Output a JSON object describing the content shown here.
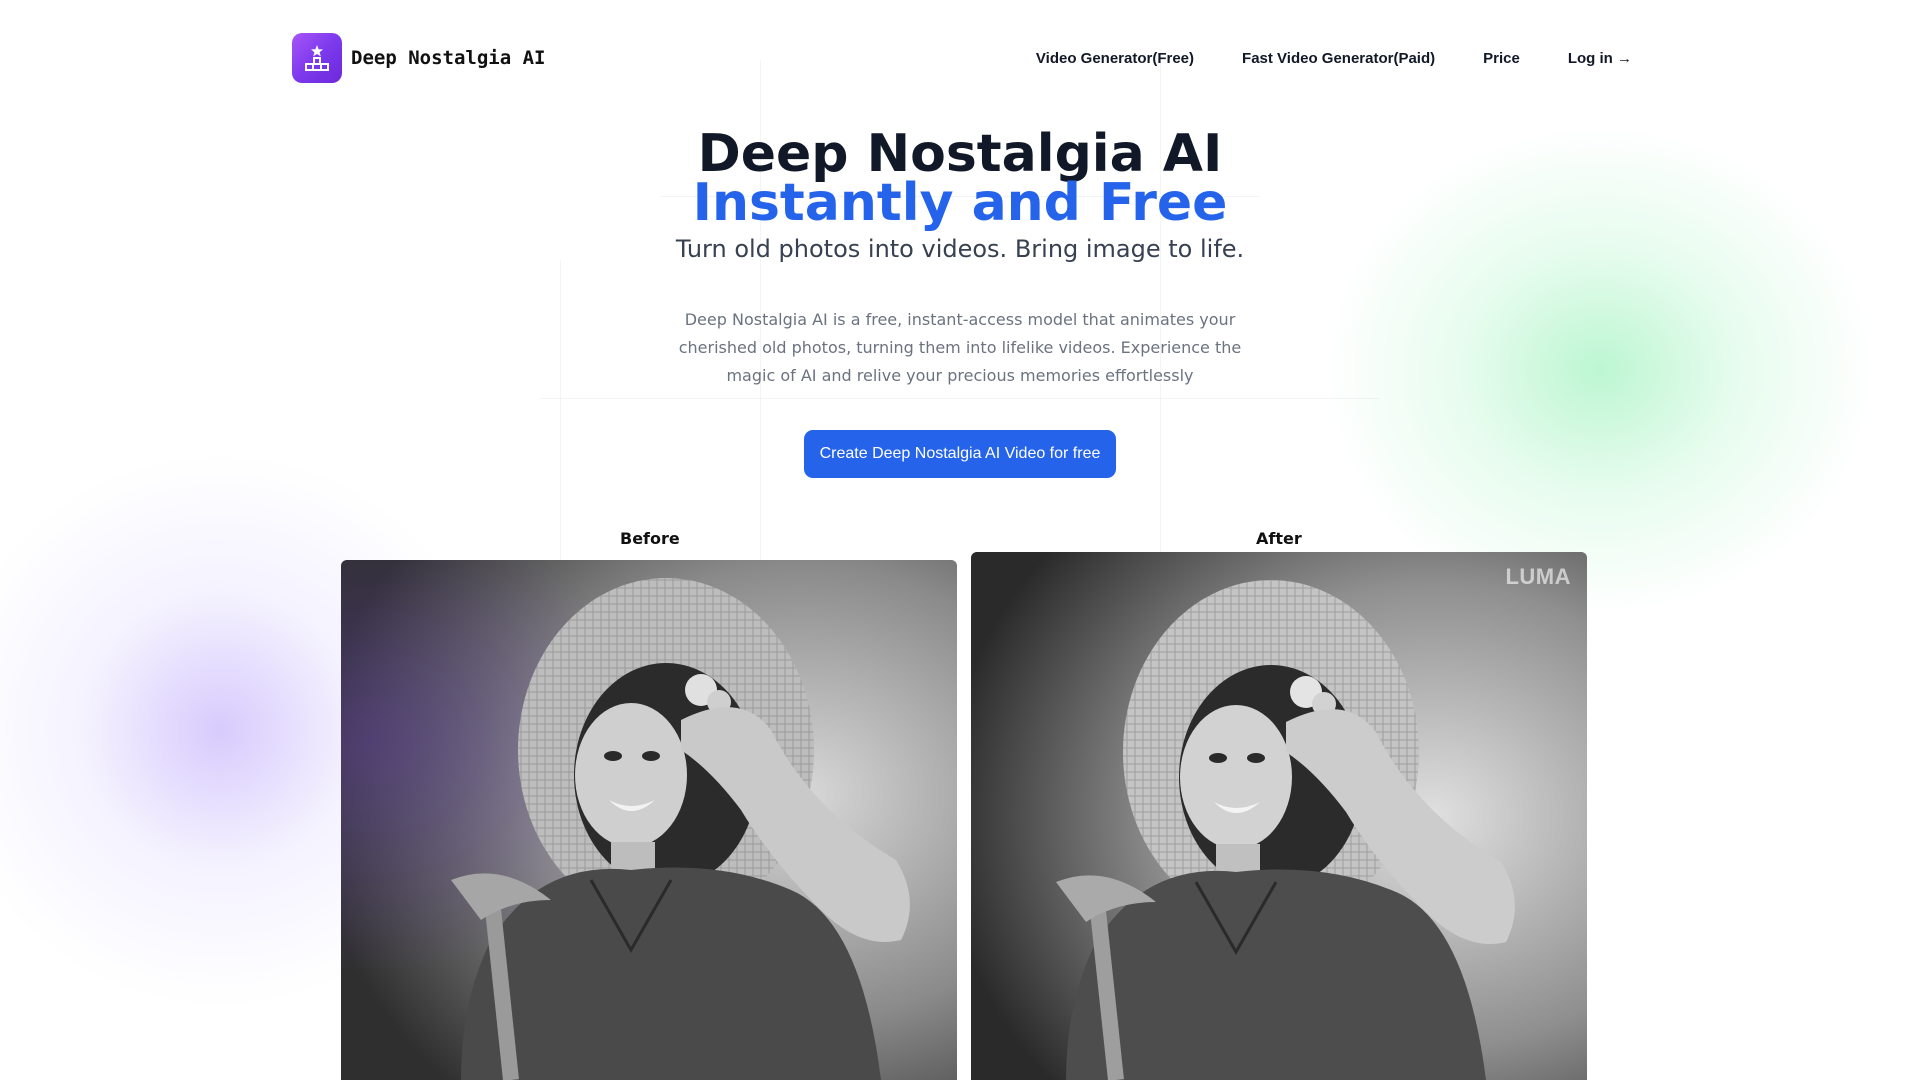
{
  "brand": {
    "name": "Deep Nostalgia AI"
  },
  "nav": [
    {
      "label": "Video Generator(Free)"
    },
    {
      "label": "Fast Video Generator(Paid)"
    },
    {
      "label": "Price"
    },
    {
      "label": "Log in →"
    }
  ],
  "hero": {
    "title": "Deep Nostalgia AI",
    "title_accent": "Instantly and Free",
    "subtitle": "Turn old photos into videos. Bring image to life.",
    "description_lines": [
      "Deep Nostalgia AI is a free, instant-access model that animates your",
      "cherished old photos, turning them into lifelike videos. Experience the",
      "magic of AI and relive your precious memories effortlessly"
    ],
    "cta_label": "Create Deep Nostalgia AI Video for free"
  },
  "compare": {
    "before_label": "Before",
    "after_label": "After",
    "watermark": "LUMA"
  },
  "colors": {
    "accent": "#2563eb",
    "logo": "#7c3aed",
    "title": "#111827",
    "description": "#6b7280"
  }
}
